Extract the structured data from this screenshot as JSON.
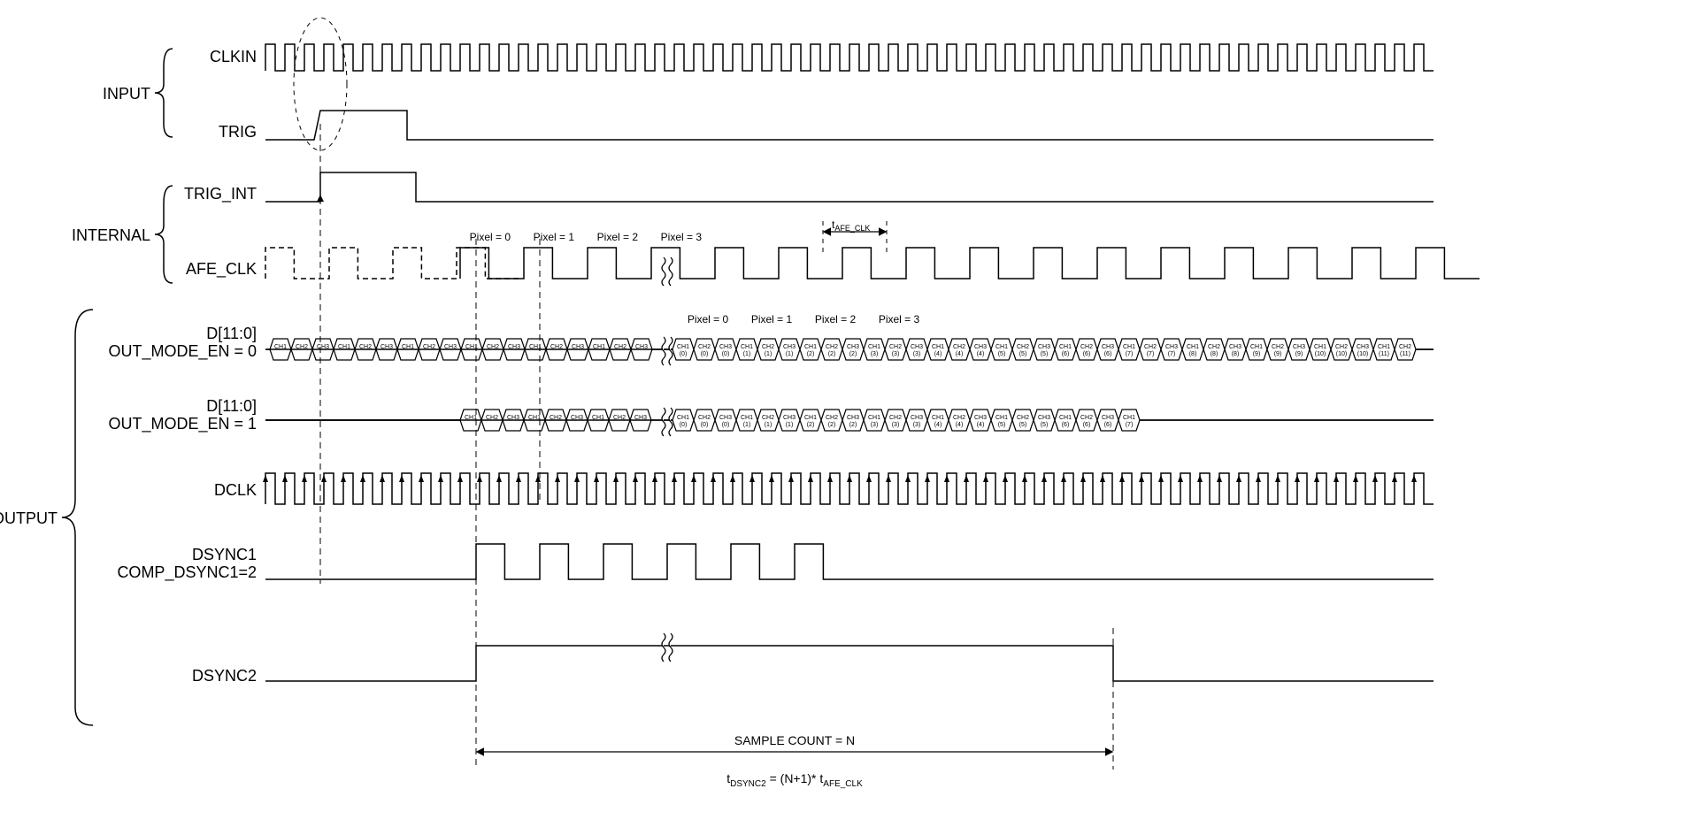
{
  "groups": {
    "input": "INPUT",
    "internal": "INTERNAL",
    "output": "OUTPUT"
  },
  "signals": {
    "clkin": "CLKIN",
    "trig": "TRIG",
    "trig_int": "TRIG_INT",
    "afe_clk": "AFE_CLK",
    "d_mode0_a": "D[11:0]",
    "d_mode0_b": "OUT_MODE_EN = 0",
    "d_mode1_a": "D[11:0]",
    "d_mode1_b": "OUT_MODE_EN = 1",
    "dclk": "DCLK",
    "dsync1_a": "DSYNC1",
    "dsync1_b": "COMP_DSYNC1=2",
    "dsync2": "DSYNC2"
  },
  "pixel_labels": [
    "Pixel = 0",
    "Pixel = 1",
    "Pixel = 2",
    "Pixel = 3"
  ],
  "t_afe_clk": "t",
  "t_afe_clk_sub": "AFE_CLK",
  "sample_count": "SAMPLE COUNT = N",
  "formula_a": "t",
  "formula_a_sub": "DSYNC2",
  "formula_b": " = (N+1)* t",
  "formula_b_sub": "AFE_CLK",
  "ch_labels": [
    "CH1",
    "CH2",
    "CH3"
  ],
  "chart_data": {
    "type": "timing-diagram",
    "description": "Digital timing diagram showing input clock CLKIN and TRIG, internal TRIG_INT and AFE_CLK, and output data buses D[11:0] in two modes, DCLK, DSYNC1 (COMP_DSYNC1=2) and DSYNC2. DSYNC2 width equals (N+1)*t_AFE_CLK where N is SAMPLE COUNT.",
    "signals": [
      {
        "name": "CLKIN",
        "group": "INPUT",
        "type": "clock"
      },
      {
        "name": "TRIG",
        "group": "INPUT",
        "type": "pulse"
      },
      {
        "name": "TRIG_INT",
        "group": "INTERNAL",
        "type": "pulse"
      },
      {
        "name": "AFE_CLK",
        "group": "INTERNAL",
        "type": "clock"
      },
      {
        "name": "D[11:0] OUT_MODE_EN=0",
        "group": "OUTPUT",
        "type": "bus",
        "cells": [
          "CH1",
          "CH2",
          "CH3"
        ],
        "indexed_after_break": true
      },
      {
        "name": "D[11:0] OUT_MODE_EN=1",
        "group": "OUTPUT",
        "type": "bus",
        "cells": [
          "CH1",
          "CH2",
          "CH3"
        ],
        "indexed_after_break": true
      },
      {
        "name": "DCLK",
        "group": "OUTPUT",
        "type": "clock-with-arrows"
      },
      {
        "name": "DSYNC1 COMP_DSYNC1=2",
        "group": "OUTPUT",
        "type": "pulse-train"
      },
      {
        "name": "DSYNC2",
        "group": "OUTPUT",
        "type": "gate",
        "width_formula": "(N+1)*t_AFE_CLK"
      }
    ],
    "annotations": {
      "pixel_markers_internal": [
        0,
        1,
        2,
        3
      ],
      "pixel_markers_output": [
        0,
        1,
        2,
        3
      ],
      "t_afe_clk_marker": true,
      "sample_count": "N"
    }
  }
}
